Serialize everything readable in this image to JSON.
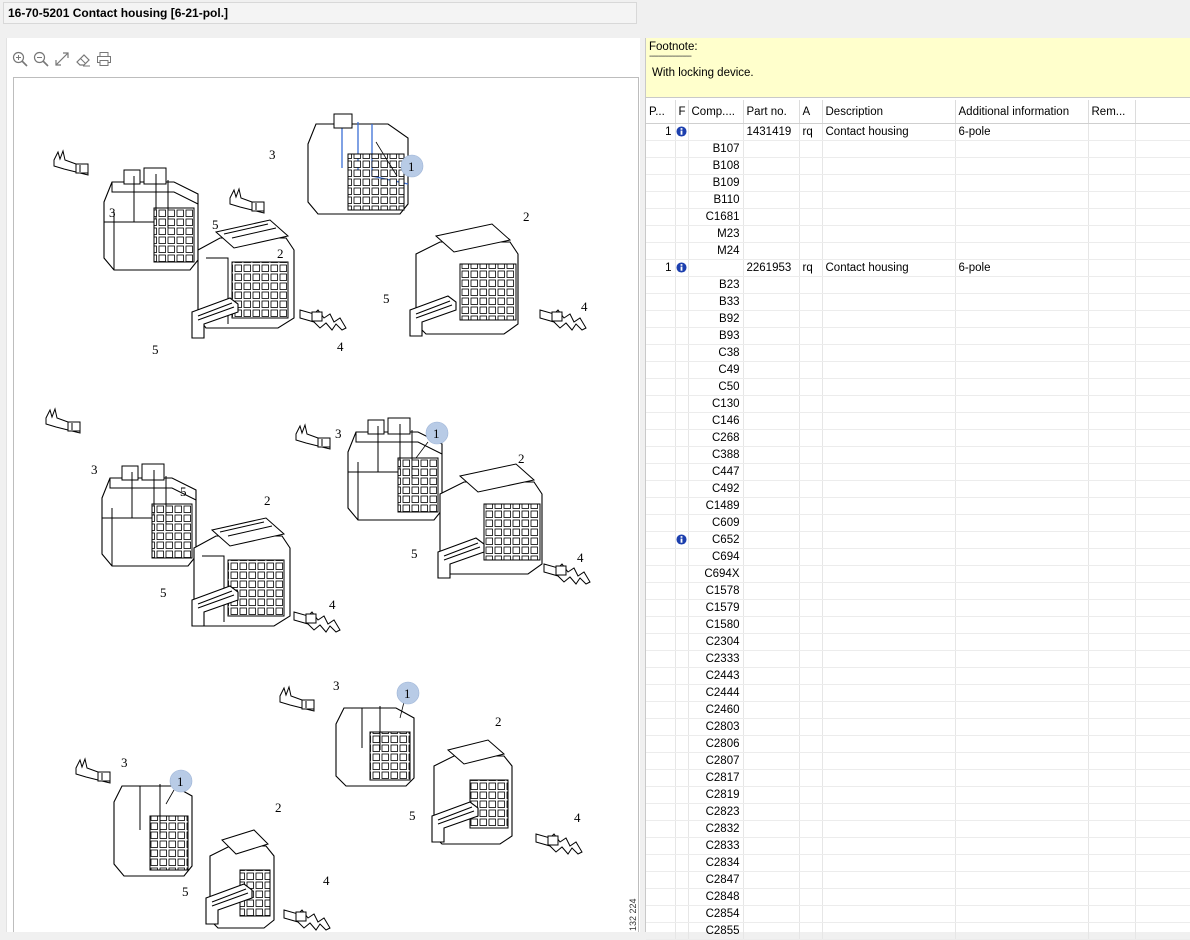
{
  "window": {
    "title": "16-70-5201 Contact housing [6-21-pol.]"
  },
  "toolbar": {
    "icons": [
      "zoom-in-icon",
      "zoom-out-icon",
      "fit-icon",
      "eraser-icon",
      "print-icon"
    ]
  },
  "drawing": {
    "id": "132 224",
    "groups": [
      {
        "n1": "1",
        "n2": "2",
        "n3": "3",
        "n4": "4",
        "n5": "5",
        "m2": "2",
        "m3": "3",
        "m4": "4",
        "m5": "5"
      },
      {
        "n1": "1",
        "n2": "2",
        "n3": "3",
        "n4": "4",
        "n5": "5",
        "m2": "2",
        "m3": "3",
        "m4": "4",
        "m5": "5"
      },
      {
        "n1": "1",
        "n2": "2",
        "n3": "3",
        "n4": "4",
        "n5": "5",
        "m1": "1",
        "m2": "2",
        "m3": "3",
        "m4": "4",
        "m5": "5"
      }
    ]
  },
  "footnote": {
    "label": "Footnote:",
    "separator": "------------------",
    "text": "With locking device."
  },
  "table": {
    "columns": [
      "P...",
      "F",
      "Comp....",
      "Part no.",
      "A",
      "Description",
      "Additional information",
      "Rem..."
    ],
    "rows": [
      {
        "pos": "1",
        "info": true,
        "comp": "",
        "part": "1431419",
        "a": "rq",
        "desc": "Contact housing",
        "add": "6-pole"
      },
      {
        "comp": "B107"
      },
      {
        "comp": "B108"
      },
      {
        "comp": "B109"
      },
      {
        "comp": "B110"
      },
      {
        "comp": "C1681"
      },
      {
        "comp": "M23"
      },
      {
        "comp": "M24"
      },
      {
        "pos": "1",
        "info": true,
        "comp": "",
        "part": "2261953",
        "a": "rq",
        "desc": "Contact housing",
        "add": "6-pole"
      },
      {
        "comp": "B23"
      },
      {
        "comp": "B33"
      },
      {
        "comp": "B92"
      },
      {
        "comp": "B93"
      },
      {
        "comp": "C38"
      },
      {
        "comp": "C49"
      },
      {
        "comp": "C50"
      },
      {
        "comp": "C130"
      },
      {
        "comp": "C146"
      },
      {
        "comp": "C268"
      },
      {
        "comp": "C388"
      },
      {
        "comp": "C447"
      },
      {
        "comp": "C492"
      },
      {
        "comp": "C1489"
      },
      {
        "comp": "C609"
      },
      {
        "info": true,
        "comp": "C652"
      },
      {
        "comp": "C694"
      },
      {
        "comp": "C694X"
      },
      {
        "comp": "C1578"
      },
      {
        "comp": "C1579"
      },
      {
        "comp": "C1580"
      },
      {
        "comp": "C2304"
      },
      {
        "comp": "C2333"
      },
      {
        "comp": "C2443"
      },
      {
        "comp": "C2444"
      },
      {
        "comp": "C2460"
      },
      {
        "comp": "C2803"
      },
      {
        "comp": "C2806"
      },
      {
        "comp": "C2807"
      },
      {
        "comp": "C2817"
      },
      {
        "comp": "C2819"
      },
      {
        "comp": "C2823"
      },
      {
        "comp": "C2832"
      },
      {
        "comp": "C2833"
      },
      {
        "comp": "C2834"
      },
      {
        "comp": "C2847"
      },
      {
        "comp": "C2848"
      },
      {
        "comp": "C2854"
      },
      {
        "comp": "C2855"
      }
    ]
  }
}
